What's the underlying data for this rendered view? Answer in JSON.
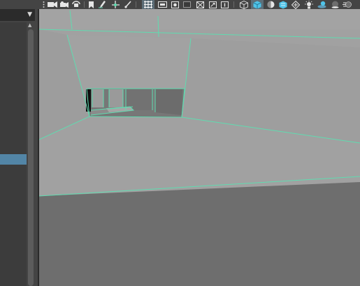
{
  "left_panel": {
    "dropdown_icon": "chevron-down-icon",
    "scroll_up_icon": "triangle-up-icon",
    "selected_item_color": "#5285a6"
  },
  "toolbar": {
    "icons": [
      "menu-dots-icon",
      "camera-icon",
      "camera-attributes-icon",
      "camera-rotate-icon",
      "bookmark-icon",
      "pencil-icon",
      "move-tool-icon",
      "brush-icon",
      "grid-icon",
      "film-gate-icon",
      "resolution-gate-icon",
      "gate-mask-icon",
      "field-chart-icon",
      "safe-action-icon",
      "safe-title-icon",
      "wireframe-icon",
      "smooth-shade-icon",
      "default-material-icon",
      "textured-icon",
      "xray-icon",
      "use-lights-icon",
      "shadows-icon",
      "ambient-occlusion-icon",
      "motion-blur-icon"
    ],
    "active_icons": [
      "grid-icon",
      "smooth-shade-icon"
    ]
  },
  "viewport": {
    "wireframe_color": "#5fdcb0",
    "surface_colors": [
      "#a2a2a2",
      "#9b9b9b",
      "#777777",
      "#6e6e6e"
    ]
  }
}
